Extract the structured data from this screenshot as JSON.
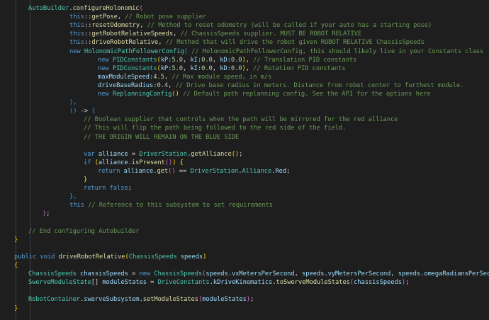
{
  "theme": {
    "bg": "#1e1e1e",
    "default": "#d4d4d4",
    "keyword": "#569cd6",
    "type": "#4ec9b0",
    "method": "#dcdcaa",
    "variable": "#9cdcfe",
    "number": "#b5cea8",
    "comment": "#6a9955",
    "bracket1": "#ffd700",
    "bracket2": "#da70d6",
    "bracket3": "#179fff"
  },
  "lines": [
    {
      "indent": 40,
      "tokens": [
        [
          "AutoBuilder",
          "type"
        ],
        [
          ".",
          ""
        ],
        [
          "configureHolonomic",
          "method"
        ],
        [
          "(",
          "bracket2"
        ]
      ]
    },
    {
      "indent": 98,
      "tokens": [
        [
          "this",
          "keyword"
        ],
        [
          "::",
          ""
        ],
        [
          "getPose",
          "method"
        ],
        [
          ", ",
          ""
        ],
        [
          "// Robot pose supplier",
          "comment"
        ]
      ]
    },
    {
      "indent": 98,
      "tokens": [
        [
          "this",
          "keyword"
        ],
        [
          "::",
          ""
        ],
        [
          "resetOdometry",
          "method"
        ],
        [
          ", ",
          ""
        ],
        [
          "// Method to reset odometry (will be called if your auto has a starting pose)",
          "comment"
        ]
      ]
    },
    {
      "indent": 98,
      "tokens": [
        [
          "this",
          "keyword"
        ],
        [
          "::",
          ""
        ],
        [
          "getRobotRelativeSpeeds",
          "method"
        ],
        [
          ", ",
          ""
        ],
        [
          "// ChassisSpeeds supplier. MUST BE ROBOT RELATIVE",
          "comment"
        ]
      ]
    },
    {
      "indent": 98,
      "tokens": [
        [
          "this",
          "keyword"
        ],
        [
          "::",
          ""
        ],
        [
          "driveRobotRelative",
          "method"
        ],
        [
          ", ",
          ""
        ],
        [
          "// Method that will drive the robot given ROBOT RELATIVE ChassisSpeeds",
          "comment"
        ]
      ]
    },
    {
      "indent": 98,
      "tokens": [
        [
          "new ",
          "keyword"
        ],
        [
          "HolonomicPathFollowerConfig",
          "type"
        ],
        [
          "(",
          "bracket3"
        ],
        [
          " ",
          ""
        ],
        [
          "// HolonomicPathFollowerConfig, this should likely live in your Constants class",
          "comment"
        ]
      ]
    },
    {
      "indent": 138,
      "tokens": [
        [
          "new ",
          "keyword"
        ],
        [
          "PIDConstants",
          "type"
        ],
        [
          "(",
          "bracket1"
        ],
        [
          "kP:",
          "variable"
        ],
        [
          "5.0",
          "number"
        ],
        [
          ", ",
          ""
        ],
        [
          "kI:",
          "variable"
        ],
        [
          "0.0",
          "number"
        ],
        [
          ", ",
          ""
        ],
        [
          "kD:",
          "variable"
        ],
        [
          "0.0",
          "number"
        ],
        [
          ")",
          "bracket1"
        ],
        [
          ", ",
          ""
        ],
        [
          "// Translation PID constants",
          "comment"
        ]
      ]
    },
    {
      "indent": 138,
      "tokens": [
        [
          "new ",
          "keyword"
        ],
        [
          "PIDConstants",
          "type"
        ],
        [
          "(",
          "bracket1"
        ],
        [
          "kP:",
          "variable"
        ],
        [
          "5.0",
          "number"
        ],
        [
          ", ",
          ""
        ],
        [
          "kI:",
          "variable"
        ],
        [
          "0.0",
          "number"
        ],
        [
          ", ",
          ""
        ],
        [
          "kD:",
          "variable"
        ],
        [
          "0.0",
          "number"
        ],
        [
          ")",
          "bracket1"
        ],
        [
          ", ",
          ""
        ],
        [
          "// Rotation PID constants",
          "comment"
        ]
      ]
    },
    {
      "indent": 138,
      "tokens": [
        [
          "maxModuleSpeed:",
          "variable"
        ],
        [
          "4.5",
          "number"
        ],
        [
          ", ",
          ""
        ],
        [
          "// Max module speed, in m/s",
          "comment"
        ]
      ]
    },
    {
      "indent": 138,
      "tokens": [
        [
          "driveBaseRadius:",
          "variable"
        ],
        [
          "0.4",
          "number"
        ],
        [
          ", ",
          ""
        ],
        [
          "// Drive base radius in meters. Distance from robot center to furthest module.",
          "comment"
        ]
      ]
    },
    {
      "indent": 138,
      "tokens": [
        [
          "new ",
          "keyword"
        ],
        [
          "ReplanningConfig",
          "type"
        ],
        [
          "()",
          "bracket1"
        ],
        [
          " ",
          ""
        ],
        [
          "// Default path replanning config. See the API for the options here",
          "comment"
        ]
      ]
    },
    {
      "indent": 98,
      "tokens": [
        [
          "),",
          "bracket3"
        ]
      ]
    },
    {
      "indent": 98,
      "tokens": [
        [
          "()",
          "bracket3"
        ],
        [
          " -> ",
          ""
        ],
        [
          "{",
          "bracket3"
        ]
      ]
    },
    {
      "indent": 118,
      "tokens": [
        [
          "// Boolean supplier that controls when the path will be mirrored for the red alliance",
          "comment"
        ]
      ]
    },
    {
      "indent": 118,
      "tokens": [
        [
          "// This will flip the path being followed to the red side of the field.",
          "comment"
        ]
      ]
    },
    {
      "indent": 118,
      "tokens": [
        [
          "// THE ORIGIN WILL REMAIN ON THE BLUE SIDE",
          "comment"
        ]
      ]
    },
    {
      "indent": 118,
      "tokens": []
    },
    {
      "indent": 118,
      "tokens": [
        [
          "var ",
          "keyword"
        ],
        [
          "alliance",
          "variable"
        ],
        [
          " = ",
          ""
        ],
        [
          "DriverStation",
          "type"
        ],
        [
          ".",
          ""
        ],
        [
          "getAlliance",
          "method"
        ],
        [
          "()",
          "bracket1"
        ],
        [
          ";",
          ""
        ]
      ]
    },
    {
      "indent": 118,
      "tokens": [
        [
          "if ",
          "keyword"
        ],
        [
          "(",
          "bracket1"
        ],
        [
          "alliance",
          "variable"
        ],
        [
          ".",
          ""
        ],
        [
          "isPresent",
          "method"
        ],
        [
          "()",
          "bracket2"
        ],
        [
          ")",
          "bracket1"
        ],
        [
          " ",
          ""
        ],
        [
          "{",
          "bracket1"
        ]
      ]
    },
    {
      "indent": 138,
      "tokens": [
        [
          "return ",
          "keyword"
        ],
        [
          "alliance",
          "variable"
        ],
        [
          ".",
          ""
        ],
        [
          "get",
          "method"
        ],
        [
          "()",
          "bracket2"
        ],
        [
          " == ",
          ""
        ],
        [
          "DriverStation",
          "type"
        ],
        [
          ".",
          ""
        ],
        [
          "Alliance",
          "type"
        ],
        [
          ".",
          ""
        ],
        [
          "Red",
          "variable"
        ],
        [
          ";",
          ""
        ]
      ]
    },
    {
      "indent": 118,
      "tokens": [
        [
          "}",
          "bracket1"
        ]
      ]
    },
    {
      "indent": 118,
      "tokens": [
        [
          "return ",
          "keyword"
        ],
        [
          "false",
          "keyword"
        ],
        [
          ";",
          ""
        ]
      ]
    },
    {
      "indent": 98,
      "tokens": [
        [
          "},",
          "bracket3"
        ]
      ]
    },
    {
      "indent": 98,
      "tokens": [
        [
          "this",
          "keyword"
        ],
        [
          " ",
          ""
        ],
        [
          "// Reference to this subsystem to set requirements",
          "comment"
        ]
      ]
    },
    {
      "indent": 60,
      "tokens": [
        [
          ")",
          "bracket2"
        ],
        [
          ";",
          ""
        ]
      ]
    },
    {
      "indent": 40,
      "tokens": []
    },
    {
      "indent": 40,
      "tokens": [
        [
          "// End configuring Autobuilder",
          "comment"
        ]
      ]
    },
    {
      "indent": 20,
      "tokens": [
        [
          "}",
          "bracket1"
        ]
      ]
    },
    {
      "indent": 20,
      "tokens": []
    },
    {
      "indent": 20,
      "tokens": [
        [
          "public ",
          "keyword"
        ],
        [
          "void ",
          "keyword"
        ],
        [
          "driveRobotRelative",
          "method"
        ],
        [
          "(",
          "bracket1"
        ],
        [
          "ChassisSpeeds",
          "type"
        ],
        [
          " ",
          ""
        ],
        [
          "speeds",
          "variable"
        ],
        [
          ")",
          "bracket1"
        ]
      ]
    },
    {
      "indent": 20,
      "tokens": [
        [
          "{",
          "bracket1"
        ]
      ]
    },
    {
      "indent": 40,
      "tokens": [
        [
          "ChassisSpeeds",
          "type"
        ],
        [
          " ",
          ""
        ],
        [
          "chassisSpeeds",
          "variable"
        ],
        [
          " = ",
          ""
        ],
        [
          "new ",
          "keyword"
        ],
        [
          "ChassisSpeeds",
          "type"
        ],
        [
          "(",
          "bracket2"
        ],
        [
          "speeds",
          "variable"
        ],
        [
          ".",
          ""
        ],
        [
          "vxMetersPerSecond",
          "variable"
        ],
        [
          ", ",
          ""
        ],
        [
          "speeds",
          "variable"
        ],
        [
          ".",
          ""
        ],
        [
          "vyMetersPerSecond",
          "variable"
        ],
        [
          ", ",
          ""
        ],
        [
          "speeds",
          "variable"
        ],
        [
          ".",
          ""
        ],
        [
          "omegaRadiansPerSecond",
          "variable"
        ],
        [
          ")",
          "bracket2"
        ],
        [
          ";",
          ""
        ]
      ]
    },
    {
      "indent": 40,
      "tokens": [
        [
          "SwerveModuleState",
          "type"
        ],
        [
          "[]",
          ""
        ],
        [
          " ",
          ""
        ],
        [
          "moduleStates",
          "variable"
        ],
        [
          " = ",
          ""
        ],
        [
          "DriveConstants",
          "type"
        ],
        [
          ".",
          ""
        ],
        [
          "kDriveKinematics",
          "variable"
        ],
        [
          ".",
          ""
        ],
        [
          "toSwerveModuleStates",
          "method"
        ],
        [
          "(",
          "bracket2"
        ],
        [
          "chassisSpeeds",
          "variable"
        ],
        [
          ")",
          "bracket2"
        ],
        [
          ";",
          ""
        ]
      ]
    },
    {
      "indent": 40,
      "tokens": []
    },
    {
      "indent": 40,
      "tokens": [
        [
          "RobotContainer",
          "type"
        ],
        [
          ".",
          ""
        ],
        [
          "swerveSubsystem",
          "variable"
        ],
        [
          ".",
          ""
        ],
        [
          "setModuleStates",
          "method"
        ],
        [
          "(",
          "bracket2"
        ],
        [
          "moduleStates",
          "variable"
        ],
        [
          ")",
          "bracket2"
        ],
        [
          ";",
          ""
        ]
      ]
    },
    {
      "indent": 20,
      "tokens": [
        [
          "}",
          "bracket1"
        ]
      ]
    }
  ]
}
